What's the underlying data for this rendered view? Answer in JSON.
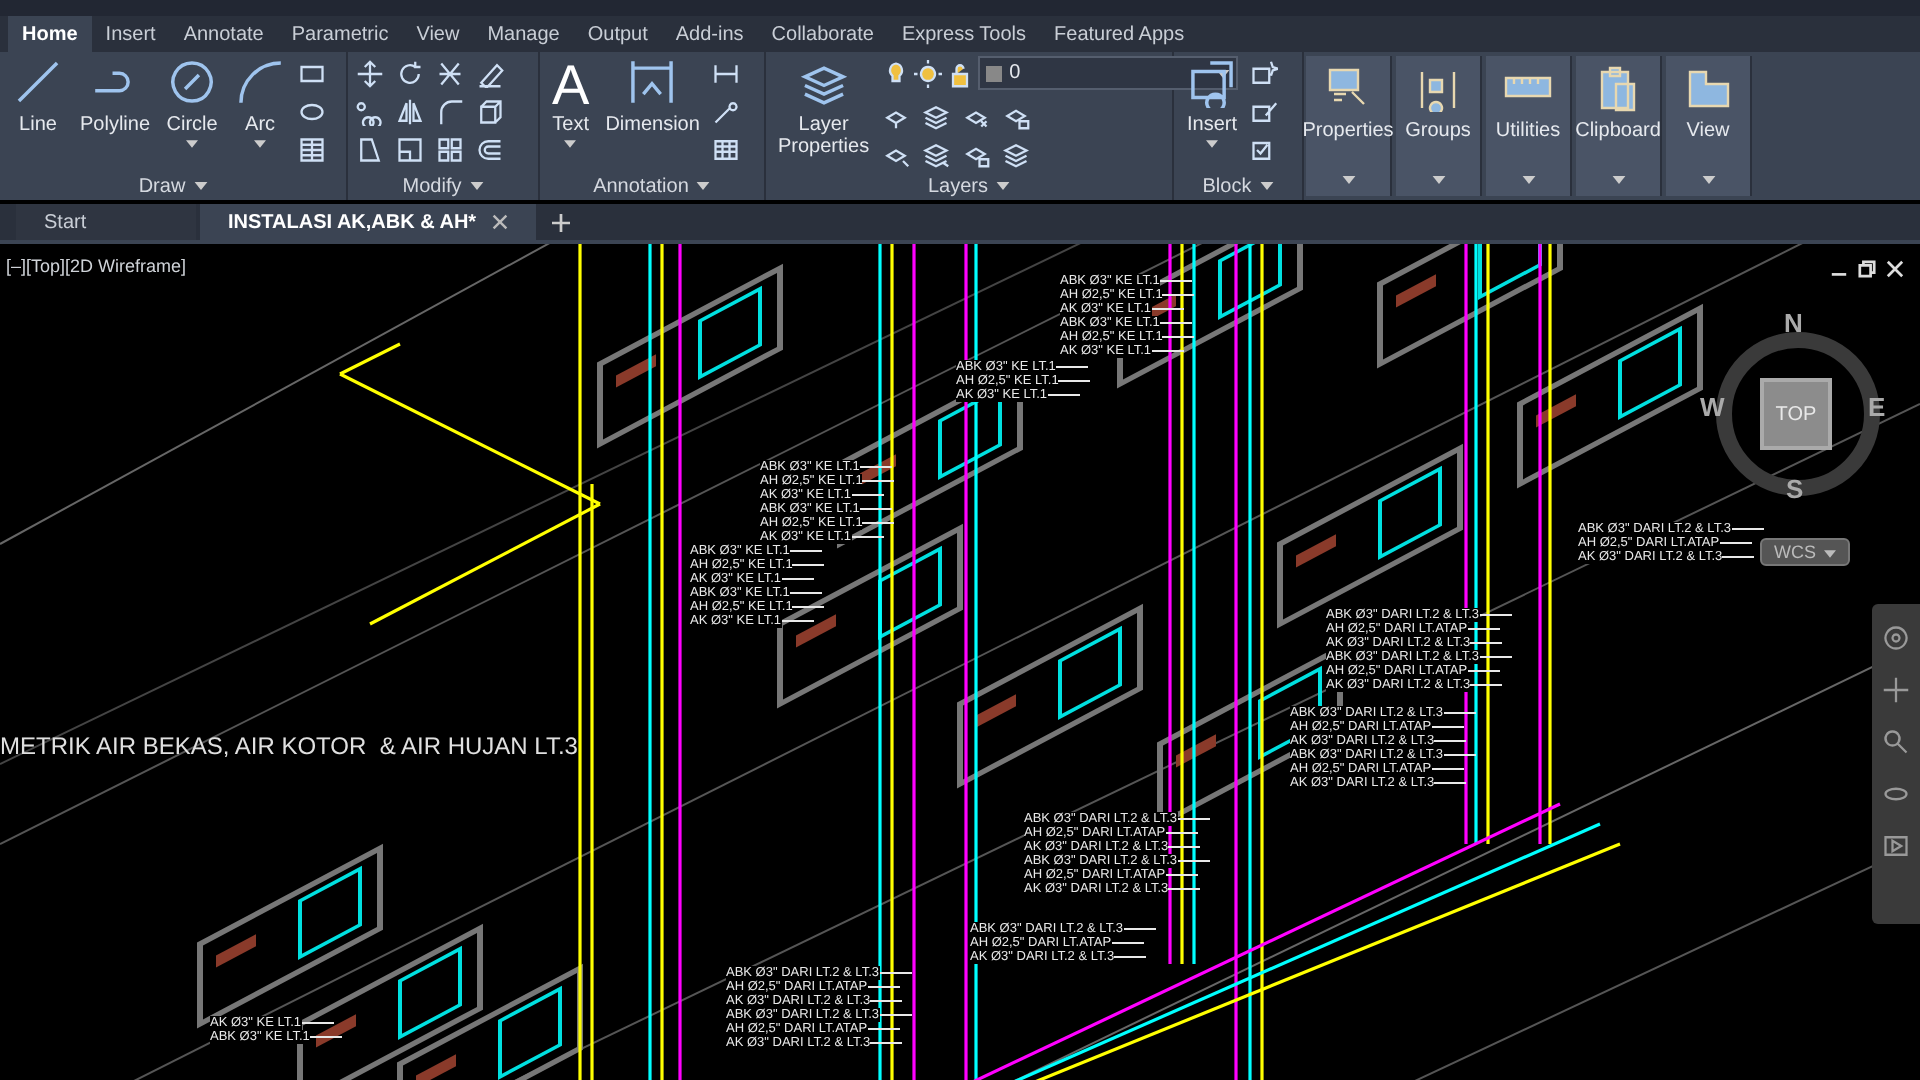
{
  "ribbon_tabs": [
    {
      "label": "Home",
      "selected": true
    },
    {
      "label": "Insert",
      "selected": false
    },
    {
      "label": "Annotate",
      "selected": false
    },
    {
      "label": "Parametric",
      "selected": false
    },
    {
      "label": "View",
      "selected": false
    },
    {
      "label": "Manage",
      "selected": false
    },
    {
      "label": "Output",
      "selected": false
    },
    {
      "label": "Add-ins",
      "selected": false
    },
    {
      "label": "Collaborate",
      "selected": false
    },
    {
      "label": "Express Tools",
      "selected": false
    },
    {
      "label": "Featured Apps",
      "selected": false
    }
  ],
  "ribbon_panels": [
    {
      "kind": "draw",
      "title": "Draw",
      "tools": [
        {
          "label": "Line",
          "has_menu": false
        },
        {
          "label": "Polyline",
          "has_menu": false
        },
        {
          "label": "Circle",
          "has_menu": true
        },
        {
          "label": "Arc",
          "has_menu": true
        }
      ]
    },
    {
      "kind": "modify",
      "title": "Modify"
    },
    {
      "kind": "annotation",
      "title": "Annotation",
      "tools": [
        {
          "label": "Text",
          "glyph": "A",
          "has_menu": true
        },
        {
          "label": "Dimension",
          "has_menu": false
        }
      ]
    },
    {
      "kind": "layers",
      "title": "Layers",
      "layer": "0",
      "tools": [
        {
          "label": "Layer Properties",
          "has_menu": false
        }
      ]
    },
    {
      "kind": "block",
      "title": "Block",
      "tools": [
        {
          "label": "Insert",
          "has_menu": true
        }
      ]
    },
    {
      "kind": "collapsed",
      "title": "Properties"
    },
    {
      "kind": "collapsed",
      "title": "Groups"
    },
    {
      "kind": "collapsed",
      "title": "Utilities"
    },
    {
      "kind": "collapsed",
      "title": "Clipboard"
    },
    {
      "kind": "collapsed",
      "title": "View"
    }
  ],
  "doc_tabs": [
    {
      "label": "Start",
      "selected": false,
      "closable": false
    },
    {
      "label": "INSTALASI AK,ABK & AH*",
      "selected": true,
      "closable": true
    }
  ],
  "viewport": {
    "label": "[–][Top][2D Wireframe]",
    "title": "METRIK AIR BEKAS, AIR KOTOR  & AIR HUJAN LT.3"
  },
  "viewcube": {
    "top": "TOP",
    "north": "N",
    "south": "S",
    "east": "E",
    "west": "W",
    "ucs": "WCS"
  },
  "pipe_labels": [
    {
      "lines": [
        "ABK Ø3\" KE LT.1",
        "AH Ø2,5\" KE LT.1",
        "AK Ø3\" KE LT.1",
        "ABK Ø3\" KE LT.1",
        "AH Ø2,5\" KE LT.1",
        "AK Ø3\" KE LT.1"
      ]
    },
    {
      "lines": [
        "ABK Ø3\" KE LT.1",
        "AH Ø2,5\" KE LT.1",
        "AK Ø3\" KE LT.1"
      ]
    },
    {
      "lines": [
        "ABK Ø3\" KE LT.1",
        "AH Ø2,5\" KE LT.1",
        "AK Ø3\" KE LT.1",
        "ABK Ø3\" KE LT.1",
        "AH Ø2,5\" KE LT.1",
        "AK Ø3\" KE LT.1"
      ]
    },
    {
      "lines": [
        "ABK Ø3\" KE LT.1",
        "AH Ø2,5\" KE LT.1",
        "AK Ø3\" KE LT.1",
        "ABK Ø3\" KE LT.1",
        "AH Ø2,5\" KE LT.1",
        "AK Ø3\" KE LT.1"
      ]
    },
    {
      "lines": [
        "ABK Ø3\" DARI LT.2 & LT.3",
        "AH Ø2,5\" DARI LT.ATAP",
        "AK Ø3\" DARI LT.2 & LT.3"
      ]
    },
    {
      "lines": [
        "ABK Ø3\" DARI LT.2 & LT.3",
        "AH Ø2,5\" DARI LT.ATAP",
        "AK Ø3\" DARI LT.2 & LT.3",
        "ABK Ø3\" DARI LT.2 & LT.3",
        "AH Ø2,5\" DARI LT.ATAP",
        "AK Ø3\" DARI LT.2 & LT.3"
      ]
    },
    {
      "lines": [
        "ABK Ø3\" DARI LT.2 & LT.3",
        "AH Ø2,5\" DARI LT.ATAP",
        "AK Ø3\" DARI LT.2 & LT.3",
        "ABK Ø3\" DARI LT.2 & LT.3",
        "AH Ø2,5\" DARI LT.ATAP",
        "AK Ø3\" DARI LT.2 & LT.3"
      ]
    },
    {
      "lines": [
        "ABK Ø3\" DARI LT.2 & LT.3",
        "AH Ø2,5\" DARI LT.ATAP",
        "AK Ø3\" DARI LT.2 & LT.3",
        "ABK Ø3\" DARI LT.2 & LT.3",
        "AH Ø2,5\" DARI LT.ATAP",
        "AK Ø3\" DARI LT.2 & LT.3"
      ]
    },
    {
      "lines": [
        "ABK Ø3\" DARI LT.2 & LT.3",
        "AH Ø2,5\" DARI LT.ATAP",
        "AK Ø3\" DARI LT.2 & LT.3"
      ]
    },
    {
      "lines": [
        "AK Ø3\" KE LT.1",
        "ABK Ø3\" KE LT.1"
      ]
    },
    {
      "lines": [
        "ABK Ø3\" DARI LT.2 & LT.3",
        "AH Ø2,5\" DARI LT.ATAP",
        "AK Ø3\" DARI LT.2 & LT.3",
        "ABK Ø3\" DARI LT.2 & LT.3",
        "AH Ø2,5\" DARI LT.ATAP",
        "AK Ø3\" DARI LT.2 & LT.3"
      ]
    }
  ]
}
